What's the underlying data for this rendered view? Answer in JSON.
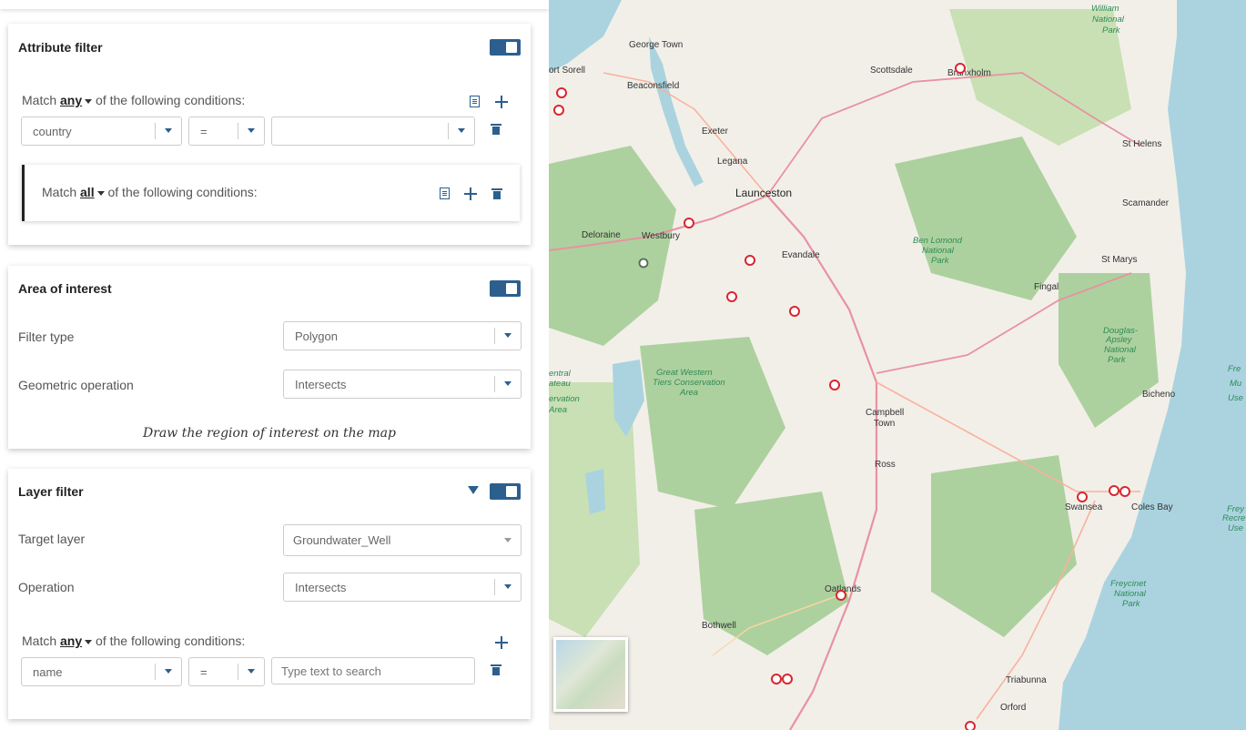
{
  "attribute_filter": {
    "title": "Attribute filter",
    "match_prefix": "Match",
    "match_mode": "any",
    "match_suffix": "of the following conditions:",
    "condition": {
      "field": "country",
      "operator": "=",
      "value": ""
    },
    "group": {
      "match_prefix": "Match",
      "match_mode": "all",
      "match_suffix": "of the following conditions:"
    }
  },
  "area_of_interest": {
    "title": "Area of interest",
    "filter_type_label": "Filter type",
    "filter_type_value": "Polygon",
    "geometric_operation_label": "Geometric operation",
    "geometric_operation_value": "Intersects",
    "hint": "Draw the region of interest on the map"
  },
  "layer_filter": {
    "title": "Layer filter",
    "target_layer_label": "Target layer",
    "target_layer_value": "Groundwater_Well",
    "operation_label": "Operation",
    "operation_value": "Intersects",
    "match_prefix": "Match",
    "match_mode": "any",
    "match_suffix": "of the following conditions:",
    "condition": {
      "field": "name",
      "operator": "=",
      "value_placeholder": "Type text to search"
    }
  },
  "map": {
    "places": [
      "George Town",
      "ort Sorell",
      "Beaconsfield",
      "Scottsdale",
      "Branxholm",
      "Exeter",
      "Legana",
      "Launceston",
      "St Helens",
      "Scamander",
      "Deloraine",
      "Westbury",
      "Evandale",
      "St Marys",
      "Fingal",
      "Bicheno",
      "Campbell",
      "Town",
      "Ross",
      "Swansea",
      "Coles Bay",
      "Oatlands",
      "Bothwell",
      "Triabunna",
      "Orford"
    ],
    "parks": [
      "Ben Lomond",
      "National",
      "Park",
      "Douglas-",
      "Apsley",
      "Great Western",
      "Tiers Conservation",
      "Area",
      "Freycinet",
      "entral",
      "ateau",
      "ervation",
      "William",
      "Fre",
      "Mu",
      "Use",
      "Frey",
      "Recre"
    ]
  }
}
